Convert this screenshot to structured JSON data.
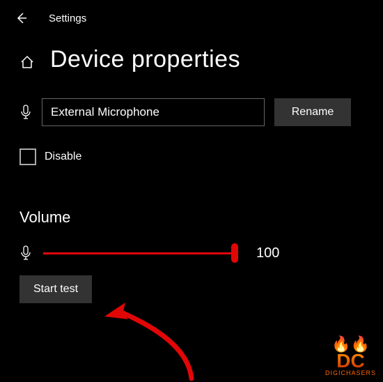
{
  "header": {
    "title": "Settings"
  },
  "page": {
    "title": "Device properties"
  },
  "device": {
    "name": "External Microphone",
    "rename_label": "Rename",
    "disable_label": "Disable"
  },
  "volume": {
    "section_label": "Volume",
    "value": "100",
    "start_test_label": "Start test"
  },
  "colors": {
    "accent": "#e20606"
  },
  "watermark": {
    "logo": "DC",
    "text": "DIGICHASERS"
  }
}
